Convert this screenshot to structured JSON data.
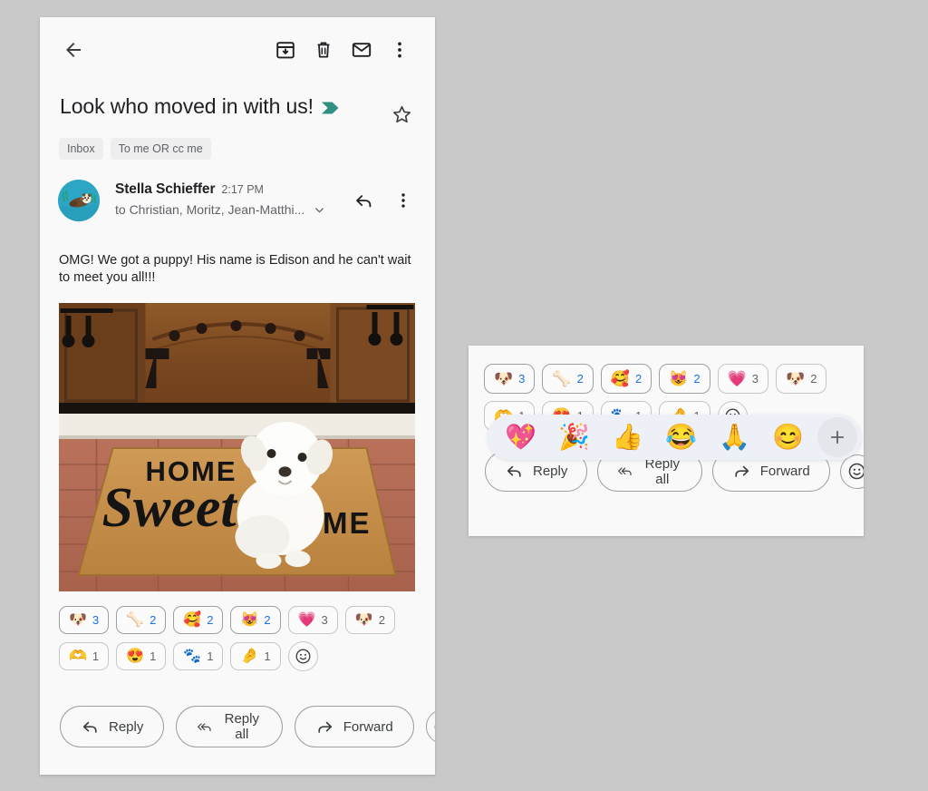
{
  "toolbar": {
    "back_icon": "arrow-back-icon",
    "archive_icon": "archive-icon",
    "delete_icon": "trash-icon",
    "unread_icon": "envelope-icon",
    "more_icon": "more-vert-icon"
  },
  "email": {
    "subject": "Look who moved in with us!",
    "label_tag_color": "#2f8f80",
    "labels": [
      "Inbox",
      "To me OR cc me"
    ],
    "star_icon": "star-outline-icon",
    "sender": {
      "name": "Stella Schieffer",
      "time": "2:17 PM",
      "recipients": "to Christian, Moritz, Jean-Matthi...",
      "expand_icon": "chevron-down-icon",
      "reply_icon": "reply-icon",
      "more_icon": "more-vert-icon",
      "avatar_name": "otter-avatar"
    },
    "body": "OMG! We got a puppy! His name is Edison and he can't wait to meet you all!!!",
    "attachment": {
      "name": "puppy-on-doormat-photo",
      "doormat_line1": "HOME SWEET",
      "doormat_script": "Sweet",
      "doormat_line2": "HOME"
    }
  },
  "reactions": {
    "row1": [
      {
        "emoji": "🐶",
        "name": "dog-face",
        "count": "3",
        "reacted": true
      },
      {
        "emoji": "🦴",
        "name": "bone",
        "count": "2",
        "reacted": true
      },
      {
        "emoji": "🥰",
        "name": "smiling-face-with-hearts",
        "count": "2",
        "reacted": true
      },
      {
        "emoji": "😻",
        "name": "cat-heart-eyes",
        "count": "2",
        "reacted": true
      },
      {
        "emoji": "💗",
        "name": "growing-heart",
        "count": "3",
        "reacted": false
      },
      {
        "emoji": "🐶",
        "name": "dog-face-2",
        "count": "2",
        "reacted": false
      }
    ],
    "row2": [
      {
        "emoji": "🫶",
        "name": "heart-hands",
        "count": "1",
        "reacted": false
      },
      {
        "emoji": "😍",
        "name": "heart-eyes",
        "count": "1",
        "reacted": false
      },
      {
        "emoji": "🐾",
        "name": "paw-prints",
        "count": "1",
        "reacted": false
      },
      {
        "emoji": "🤌",
        "name": "pinched-fingers",
        "count": "1",
        "reacted": false
      }
    ],
    "add_reaction_icon": "add-reaction-smiley-icon"
  },
  "footer": {
    "reply_label": "Reply",
    "reply_all_label": "Reply all",
    "forward_label": "Forward",
    "reply_icon": "reply-icon",
    "reply_all_icon": "reply-all-icon",
    "forward_icon": "forward-icon",
    "emoji_button_icon": "add-reaction-smiley-icon"
  },
  "picker": {
    "emojis": [
      {
        "emoji": "💖",
        "name": "sparkling-heart"
      },
      {
        "emoji": "🎉",
        "name": "party-popper"
      },
      {
        "emoji": "👍",
        "name": "thumbs-up"
      },
      {
        "emoji": "😂",
        "name": "face-with-tears-of-joy"
      },
      {
        "emoji": "🙏",
        "name": "folded-hands"
      },
      {
        "emoji": "😊",
        "name": "smiling-face-with-smiling-eyes"
      }
    ],
    "more_label": "+",
    "more_name": "more-emojis-button"
  },
  "colors": {
    "page_background": "#c9c9c9",
    "panel_background": "#f9f9f9",
    "accent_blue": "#1a73e8",
    "text_primary": "#202124",
    "text_secondary": "#5f6368",
    "picker_background": "#eef0f8"
  }
}
